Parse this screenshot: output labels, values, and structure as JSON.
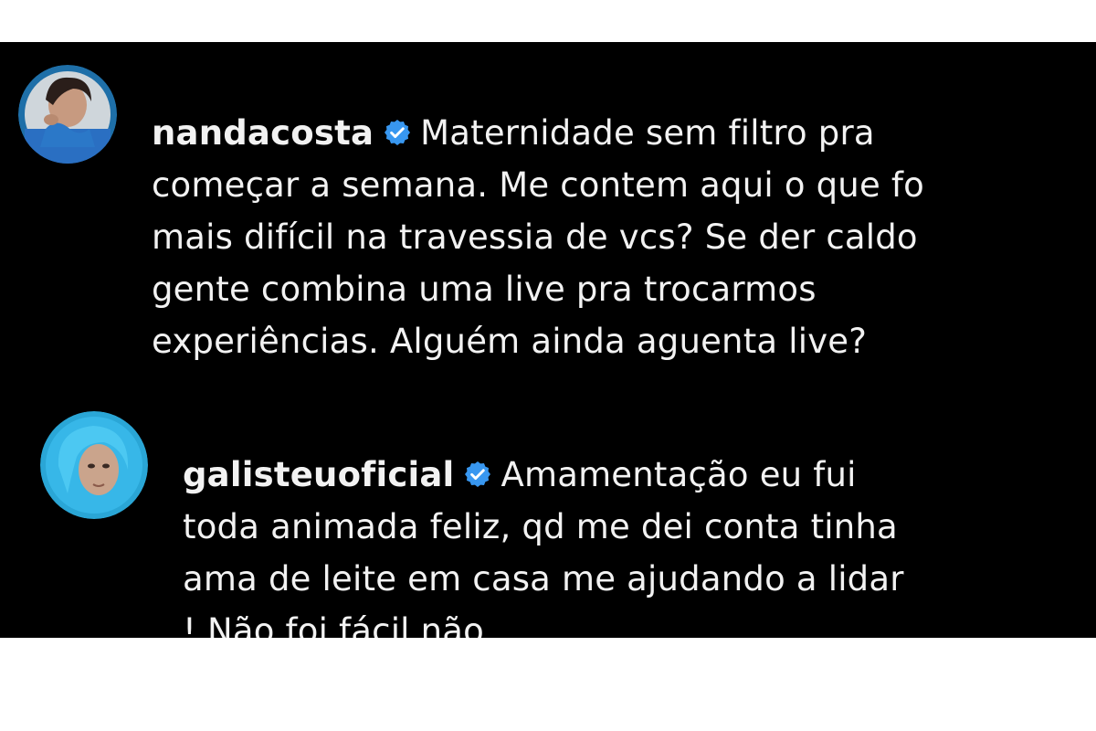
{
  "comments": [
    {
      "username": "nandacosta",
      "verified": true,
      "verified_icon": "verified-badge-icon",
      "avatar_icon": "avatar-nandacosta",
      "badge_color": "#3897f0",
      "lines": [
        "Maternidade sem filtro pra",
        "começar a semana. Me contem aqui o que fo",
        "mais difícil na travessia de vcs? Se der caldo",
        "gente combina uma live pra trocarmos",
        "experiências. Alguém ainda aguenta live?"
      ]
    },
    {
      "username": "galisteuoficial",
      "verified": true,
      "verified_icon": "verified-badge-icon",
      "avatar_icon": "avatar-galisteuoficial",
      "badge_color": "#3897f0",
      "lines": [
        "Amamentação eu fui",
        "toda animada feliz, qd me dei conta tinha",
        "ama de leite em casa me ajudando a lidar",
        "! Não foi fácil não"
      ]
    }
  ]
}
